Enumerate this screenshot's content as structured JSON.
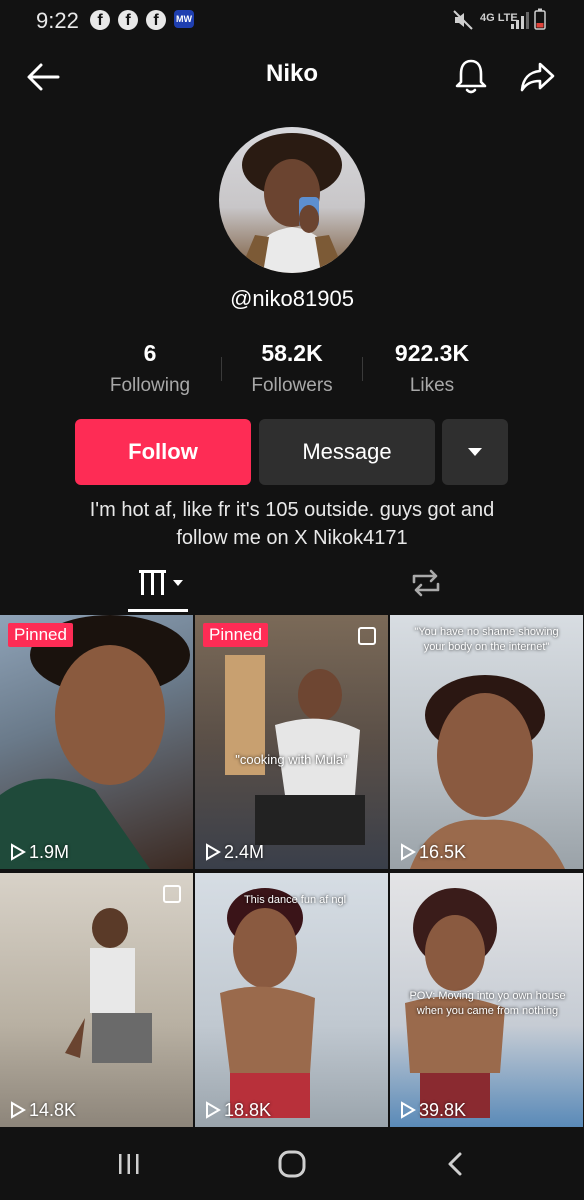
{
  "status_bar": {
    "time": "9:22",
    "network": "4G LTE"
  },
  "header": {
    "title": "Niko"
  },
  "profile": {
    "username": "@niko81905",
    "stats": [
      {
        "value": "6",
        "label": "Following"
      },
      {
        "value": "58.2K",
        "label": "Followers"
      },
      {
        "value": "922.3K",
        "label": "Likes"
      }
    ],
    "follow_label": "Follow",
    "message_label": "Message",
    "bio_line1": "I'm hot af, like fr it's 105 outside. guys got and",
    "bio_line2": "follow me on X Nikok4171"
  },
  "videos": [
    {
      "pinned": "Pinned",
      "views": "1.9M",
      "caption": ""
    },
    {
      "pinned": "Pinned",
      "views": "2.4M",
      "caption": "\"cooking with Mula\""
    },
    {
      "pinned": "",
      "views": "16.5K",
      "caption": "\"You have no shame showing your body on the internet\""
    },
    {
      "pinned": "",
      "views": "14.8K",
      "caption": ""
    },
    {
      "pinned": "",
      "views": "18.8K",
      "caption": "This dance fun af ngl"
    },
    {
      "pinned": "",
      "views": "39.8K",
      "caption": "POV: Moving into yo own house when you came from nothing"
    }
  ],
  "colors": {
    "accent": "#fe2c55",
    "background": "#121212",
    "secondary_button": "#2f2f2f"
  }
}
